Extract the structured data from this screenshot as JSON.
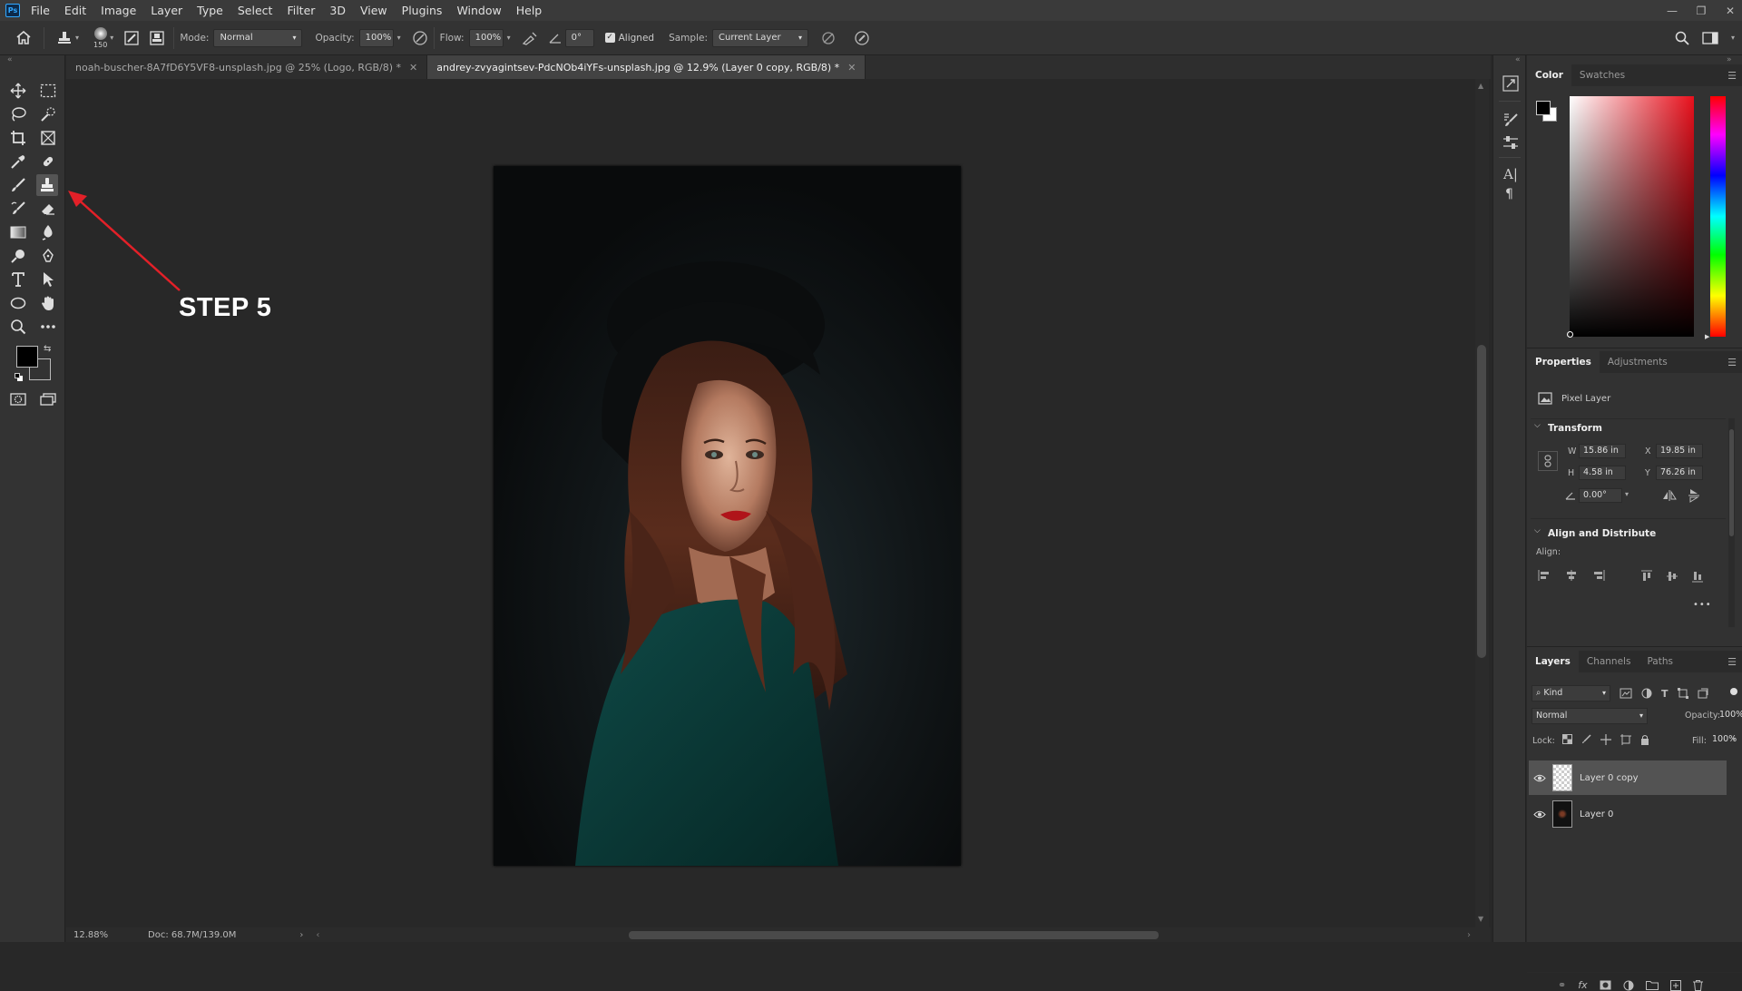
{
  "app": {
    "logo": "Ps"
  },
  "menu": [
    "File",
    "Edit",
    "Image",
    "Layer",
    "Type",
    "Select",
    "Filter",
    "3D",
    "View",
    "Plugins",
    "Window",
    "Help"
  ],
  "window_controls": {
    "minimize": "—",
    "restore": "❐",
    "close": "✕"
  },
  "options_bar": {
    "brush_size": "150",
    "mode_label": "Mode:",
    "mode_value": "Normal",
    "opacity_label": "Opacity:",
    "opacity_value": "100%",
    "flow_label": "Flow:",
    "flow_value": "100%",
    "angle_value": "0°",
    "aligned_label": "Aligned",
    "aligned_checked": true,
    "sample_label": "Sample:",
    "sample_value": "Current Layer"
  },
  "document_tabs": [
    {
      "label": "noah-buscher-8A7fD6Y5VF8-unsplash.jpg @ 25% (Logo, RGB/8) *",
      "active": false
    },
    {
      "label": "andrey-zvyagintsev-PdcNOb4iYFs-unsplash.jpg @ 12.9% (Layer 0 copy, RGB/8) *",
      "active": true
    }
  ],
  "status_bar": {
    "zoom": "12.88%",
    "doc_info": "Doc: 68.7M/139.0M"
  },
  "annotation": {
    "text": "STEP 5"
  },
  "color_panel": {
    "tabs": [
      "Color",
      "Swatches"
    ],
    "active": "Color",
    "foreground": "#000000",
    "background": "#ffffff",
    "hue_color": "#e8101c"
  },
  "properties_panel": {
    "tabs": [
      "Properties",
      "Adjustments"
    ],
    "active": "Properties",
    "layer_type": "Pixel Layer",
    "transform_title": "Transform",
    "w_label": "W",
    "w_value": "15.86 in",
    "x_label": "X",
    "x_value": "19.85 in",
    "h_label": "H",
    "h_value": "4.58 in",
    "y_label": "Y",
    "y_value": "76.26 in",
    "angle_value": "0.00°",
    "align_title": "Align and Distribute",
    "align_label": "Align:",
    "more": "•••"
  },
  "layers_panel": {
    "tabs": [
      "Layers",
      "Channels",
      "Paths"
    ],
    "active": "Layers",
    "kind_filter": "Kind",
    "blend_mode": "Normal",
    "opacity_label": "Opacity:",
    "opacity_value": "100%",
    "lock_label": "Lock:",
    "fill_label": "Fill:",
    "fill_value": "100%",
    "layers": [
      {
        "name": "Layer 0 copy",
        "selected": true,
        "visible": true
      },
      {
        "name": "Layer 0",
        "selected": false,
        "visible": true
      }
    ]
  }
}
